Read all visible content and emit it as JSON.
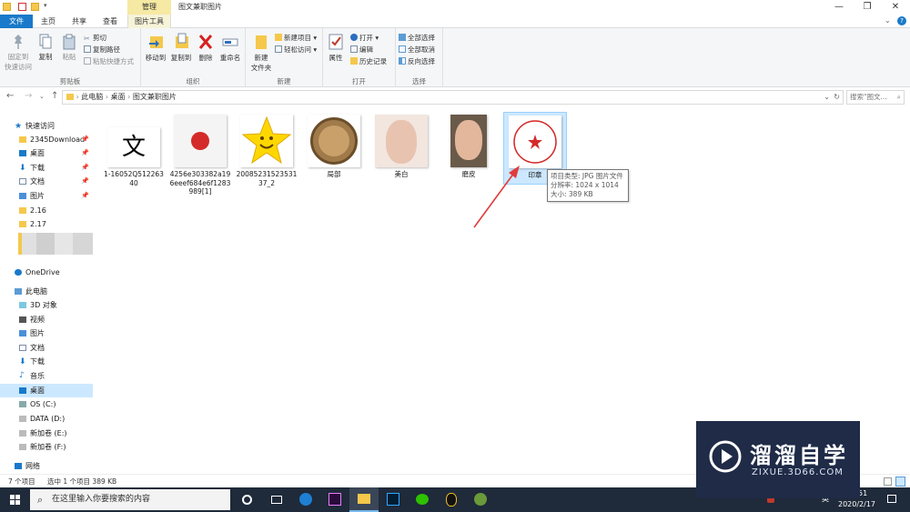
{
  "window": {
    "title": "图文兼职图片",
    "context_tab_group": "管理",
    "controls": {
      "minimize": "—",
      "maximize": "❐",
      "close": "✕"
    }
  },
  "tabs": [
    "文件",
    "主页",
    "共享",
    "查看",
    "图片工具"
  ],
  "ribbon": {
    "clipboard": {
      "pin_to_quick": "固定到\n快速访问",
      "copy": "复制",
      "paste": "粘贴",
      "cut": "剪切",
      "copy_path": "复制路径",
      "paste_shortcut": "粘贴快捷方式",
      "label": "剪贴板"
    },
    "organize": {
      "move_to": "移动到",
      "copy_to": "复制到",
      "delete": "删除",
      "rename": "重命名",
      "label": "组织"
    },
    "new": {
      "new_folder": "新建\n文件夹",
      "new_item": "新建项目 ▾",
      "easy_access": "轻松访问 ▾",
      "label": "新建"
    },
    "open": {
      "properties": "属性",
      "open": "打开 ▾",
      "edit": "编辑",
      "history": "历史记录",
      "label": "打开"
    },
    "select": {
      "select_all": "全部选择",
      "select_none": "全部取消",
      "invert": "反向选择",
      "label": "选择"
    }
  },
  "address": {
    "path": [
      "此电脑",
      "桌面",
      "图文兼职图片"
    ],
    "search_placeholder": "搜索\"图文...",
    "refresh": "↻"
  },
  "sidebar": {
    "quick_access": "快速访问",
    "items": [
      {
        "label": "2345Download",
        "pinned": true
      },
      {
        "label": "桌面",
        "pinned": true
      },
      {
        "label": "下载",
        "pinned": true
      },
      {
        "label": "文档",
        "pinned": true
      },
      {
        "label": "图片",
        "pinned": true
      },
      {
        "label": "2.16"
      },
      {
        "label": "2.17"
      }
    ],
    "onedrive": "OneDrive",
    "this_pc": "此电脑",
    "pc_items": [
      "3D 对象",
      "视频",
      "图片",
      "文档",
      "下载",
      "音乐",
      "桌面",
      "OS (C:)",
      "DATA (D:)",
      "新加卷 (E:)",
      "新加卷 (F:)"
    ],
    "network": "网络"
  },
  "files": [
    {
      "name": "1-16052Q51226340"
    },
    {
      "name": "4256e303382a196eeef684e6f1283989[1]"
    },
    {
      "name": "2008523152353137_2"
    },
    {
      "name": "局部"
    },
    {
      "name": "美白"
    },
    {
      "name": "磨皮"
    },
    {
      "name": "印章",
      "selected": true
    }
  ],
  "tooltip": {
    "type": "项目类型: JPG 图片文件",
    "resolution": "分辨率: 1024 x 1014",
    "size": "大小: 389 KB"
  },
  "status": {
    "count": "7 个项目",
    "selected": "选中 1 个项目  389 KB"
  },
  "taskbar": {
    "search_placeholder": "在这里输入你要搜索的内容",
    "ime": "英",
    "date": "2020/2/17",
    "time_partial": "51"
  },
  "watermark": {
    "title": "溜溜自学",
    "url": "ZIXUE.3D66.COM"
  },
  "colors": {
    "accent": "#1979ca",
    "selection": "#cce8ff",
    "taskbar": "#1f2a3a",
    "arrow": "#e03c3c"
  }
}
